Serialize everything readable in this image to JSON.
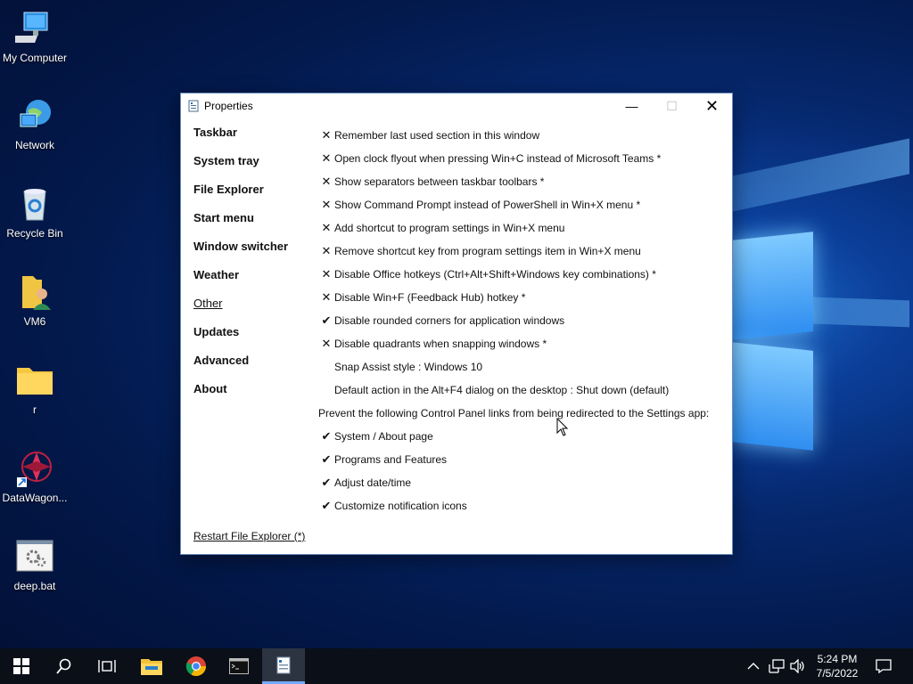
{
  "desktop": {
    "icons": [
      {
        "label": "My Computer"
      },
      {
        "label": "Network"
      },
      {
        "label": "Recycle Bin"
      },
      {
        "label": "VM6"
      },
      {
        "label": "r"
      },
      {
        "label": "DataWagon..."
      },
      {
        "label": "deep.bat"
      }
    ]
  },
  "window": {
    "title": "Properties",
    "sidebar": [
      {
        "label": "Taskbar"
      },
      {
        "label": "System tray"
      },
      {
        "label": "File Explorer"
      },
      {
        "label": "Start menu"
      },
      {
        "label": "Window switcher"
      },
      {
        "label": "Weather"
      },
      {
        "label": "Other",
        "active": true
      },
      {
        "label": "Updates"
      },
      {
        "label": "Advanced"
      },
      {
        "label": "About"
      }
    ],
    "options": [
      {
        "mark": "✕",
        "label": "Remember last used section in this window"
      },
      {
        "mark": "✕",
        "label": "Open clock flyout when pressing Win+C instead of Microsoft Teams *"
      },
      {
        "mark": "✕",
        "label": "Show separators between taskbar toolbars *"
      },
      {
        "mark": "✕",
        "label": "Show Command Prompt instead of PowerShell in Win+X menu *"
      },
      {
        "mark": "✕",
        "label": "Add shortcut to program settings in Win+X menu"
      },
      {
        "mark": "✕",
        "label": "Remove shortcut key from program settings item in Win+X menu"
      },
      {
        "mark": "✕",
        "label": "Disable Office hotkeys (Ctrl+Alt+Shift+Windows key combinations) *"
      },
      {
        "mark": "✕",
        "label": "Disable Win+F (Feedback Hub) hotkey *"
      },
      {
        "mark": "✔",
        "label": "Disable rounded corners for application windows"
      },
      {
        "mark": "✕",
        "label": "Disable quadrants when snapping windows *"
      },
      {
        "mark": "",
        "label": "Snap Assist style : Windows 10"
      },
      {
        "mark": "",
        "label": "Default action in the Alt+F4 dialog on the desktop : Shut down (default)"
      },
      {
        "mark": null,
        "label": "Prevent the following Control Panel links from being redirected to the Settings app:"
      },
      {
        "mark": "✔",
        "label": "System / About page"
      },
      {
        "mark": "✔",
        "label": "Programs and Features"
      },
      {
        "mark": "✔",
        "label": "Adjust date/time"
      },
      {
        "mark": "✔",
        "label": "Customize notification icons"
      }
    ],
    "restart_link": "Restart File Explorer (*)"
  },
  "taskbar": {
    "clock_time": "5:24 PM",
    "clock_date": "7/5/2022"
  }
}
